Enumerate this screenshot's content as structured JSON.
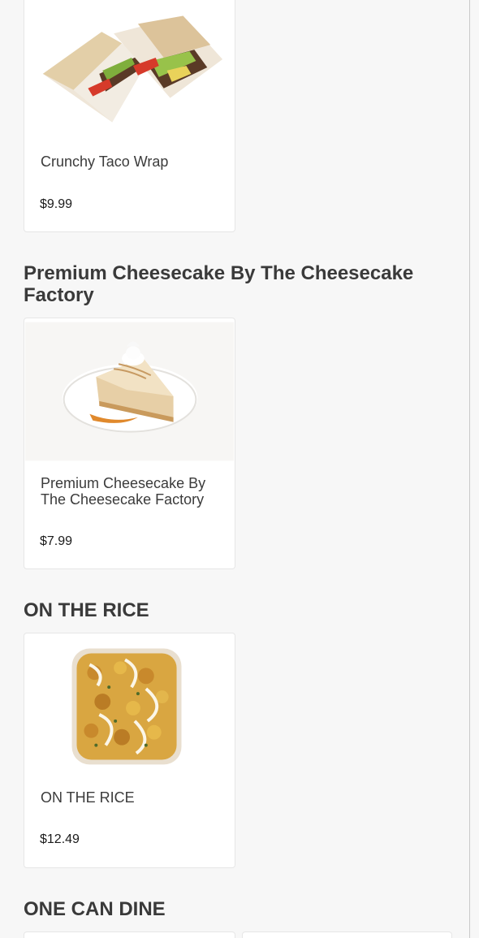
{
  "sections": [
    {
      "items": [
        {
          "name": "Crunchy Taco Wrap",
          "price": "$9.99",
          "image": "taco-wrap-image"
        }
      ]
    },
    {
      "title": "Premium Cheesecake By The Cheesecake Factory",
      "items": [
        {
          "name": "Premium Cheesecake By The Cheesecake Factory",
          "price": "$7.99",
          "image": "cheesecake-image"
        }
      ]
    },
    {
      "title": "ON THE RICE",
      "items": [
        {
          "name": "ON THE RICE",
          "price": "$12.49",
          "image": "rice-bowl-image"
        }
      ]
    },
    {
      "title": "ONE CAN DINE",
      "items": []
    }
  ],
  "colors": {
    "background": "#f7f7f7",
    "card": "#ffffff",
    "card_border": "#e6e6e6",
    "title_text": "#3a3a3a",
    "price_text": "#1a1a1a"
  }
}
